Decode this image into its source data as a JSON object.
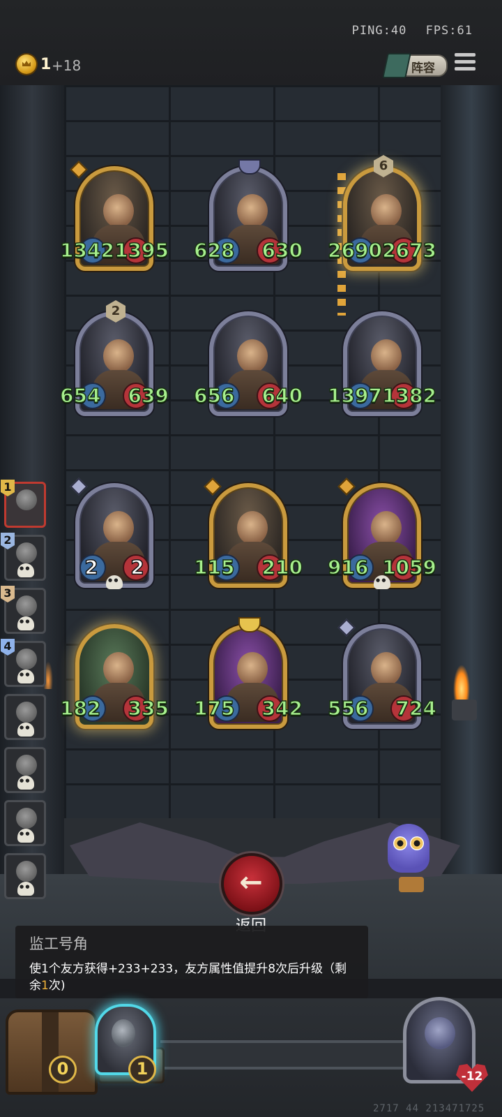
{
  "status": {
    "ping_label": "PING:40",
    "fps_label": "FPS:61"
  },
  "currency": {
    "gold": "1",
    "increment": "+18"
  },
  "top_buttons": {
    "lineup_label": "阵容"
  },
  "board": {
    "cards": [
      {
        "attack": "1342",
        "health": "1395"
      },
      {
        "attack": "628",
        "health": "630"
      },
      {
        "attack": "2690",
        "health": "2673",
        "level": "6"
      },
      {
        "attack": "654",
        "health": "639",
        "level": "2"
      },
      {
        "attack": "656",
        "health": "640"
      },
      {
        "attack": "1397",
        "health": "1382"
      },
      {
        "attack": "2",
        "health": "2"
      },
      {
        "attack": "115",
        "health": "210"
      },
      {
        "attack": "916",
        "health": "1059"
      },
      {
        "attack": "182",
        "health": "335"
      },
      {
        "attack": "175",
        "health": "342"
      },
      {
        "attack": "556",
        "health": "724"
      }
    ]
  },
  "sidebar": {
    "slots": [
      {
        "rank": "1"
      },
      {
        "rank": "2"
      },
      {
        "rank": "3"
      },
      {
        "rank": "4"
      },
      {
        "rank": ""
      },
      {
        "rank": ""
      },
      {
        "rank": ""
      },
      {
        "rank": ""
      }
    ]
  },
  "back_button": {
    "label": "返回"
  },
  "tooltip": {
    "title": "监工号角",
    "desc_before": "使1个友方获得+233+233，友方属性值提升8次后升级（剩余",
    "desc_highlight": "1",
    "desc_after": "次)"
  },
  "bottom": {
    "chest_count": "0",
    "hero_count": "1",
    "enemy_health": "-12",
    "debug_numbers": "2717 44 213471725"
  },
  "colors": {
    "stat_green": "#a7f08e",
    "highlight": "#f0b33a",
    "back_red": "#c8303a",
    "cyan_glow": "#52d8e8"
  }
}
